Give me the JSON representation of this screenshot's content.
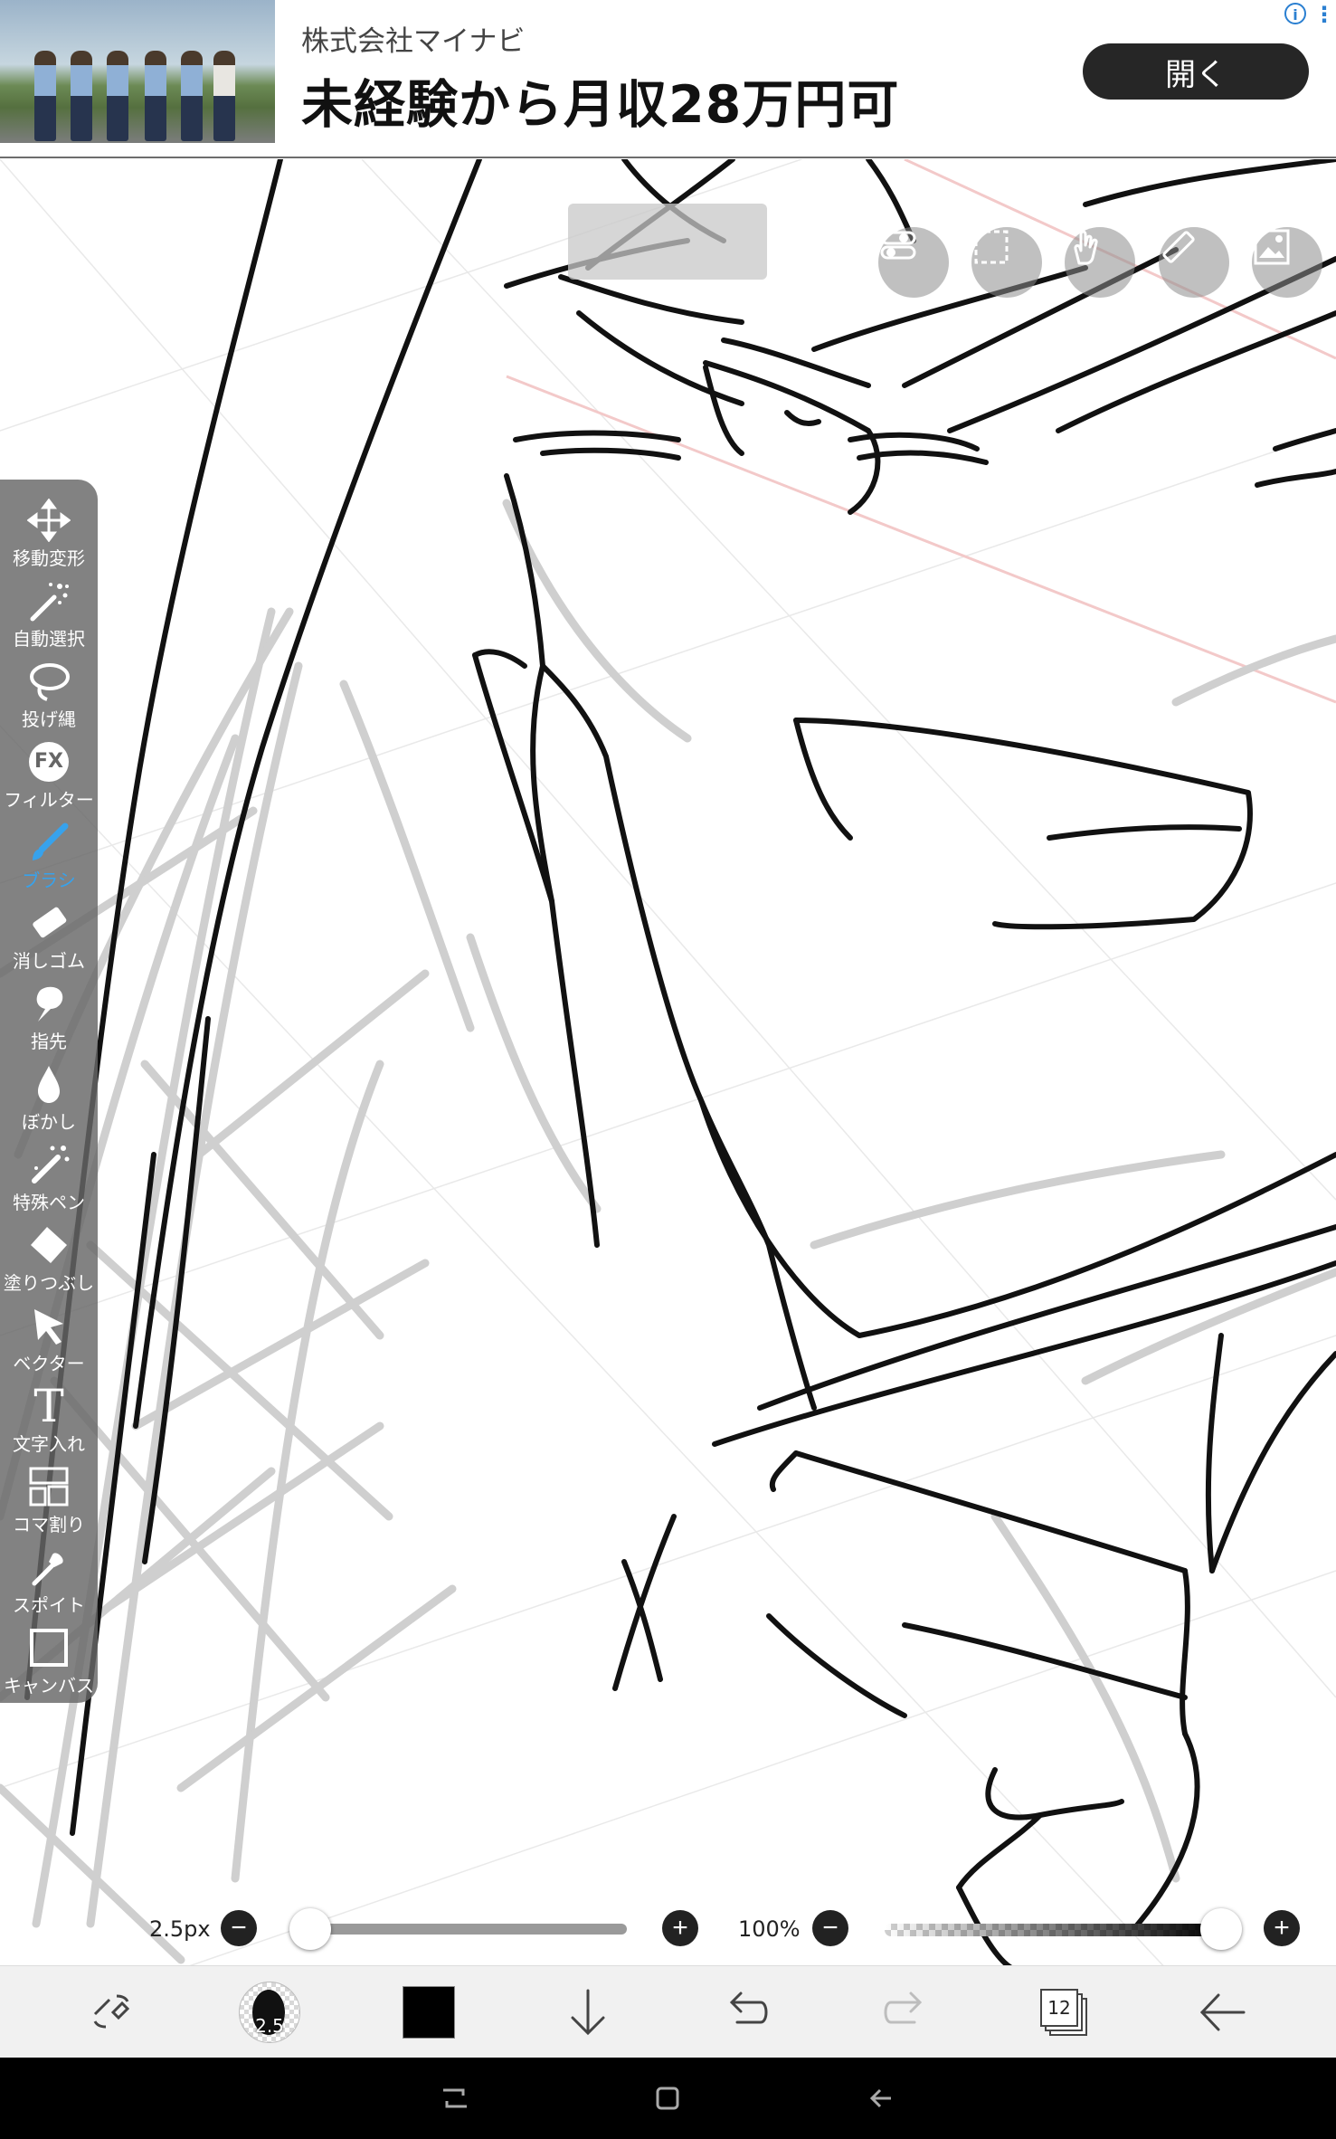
{
  "ad": {
    "company": "株式会社マイナビ",
    "headline": "未経験から月収28万円可",
    "open_button": "開く",
    "info_icon": "info-icon",
    "more_icon": "more-vertical-icon"
  },
  "toolbar": {
    "tools": [
      {
        "label": "移動変形",
        "icon": "move-transform-icon",
        "active": false
      },
      {
        "label": "自動選択",
        "icon": "magic-wand-icon",
        "active": false
      },
      {
        "label": "投げ縄",
        "icon": "lasso-icon",
        "active": false
      },
      {
        "label": "フィルター",
        "icon": "filter-fx-icon",
        "active": false
      },
      {
        "label": "ブラシ",
        "icon": "brush-icon",
        "active": true
      },
      {
        "label": "消しゴム",
        "icon": "eraser-icon",
        "active": false
      },
      {
        "label": "指先",
        "icon": "finger-smudge-icon",
        "active": false
      },
      {
        "label": "ぼかし",
        "icon": "blur-drop-icon",
        "active": false
      },
      {
        "label": "特殊ペン",
        "icon": "special-pen-icon",
        "active": false
      },
      {
        "label": "塗りつぶし",
        "icon": "fill-bucket-icon",
        "active": false
      },
      {
        "label": "ベクター",
        "icon": "vector-cursor-icon",
        "active": false
      },
      {
        "label": "文字入れ",
        "icon": "text-icon",
        "active": false
      },
      {
        "label": "コマ割り",
        "icon": "panel-divide-icon",
        "active": false
      },
      {
        "label": "スポイト",
        "icon": "eyedropper-icon",
        "active": false
      },
      {
        "label": "キャンバス",
        "icon": "canvas-icon",
        "active": false
      }
    ],
    "text_glyph": "T",
    "fx_glyph": "FX"
  },
  "top_buttons": [
    "settings-toggle-icon",
    "selection-icon",
    "touch-hand-icon",
    "ruler-icon",
    "image-layer-icon"
  ],
  "brush": {
    "size_label": "2.5px",
    "size_fraction": 0.05,
    "opacity_label": "100%",
    "opacity_fraction": 1.0,
    "minus": "−",
    "plus": "+"
  },
  "bottom_bar": {
    "brush_size_badge": "2.5",
    "layer_count": "12",
    "current_color": "#000000"
  },
  "colors": {
    "accent": "#37a2ec",
    "toolbar_bg": "#666666",
    "ad_button": "#262626"
  }
}
